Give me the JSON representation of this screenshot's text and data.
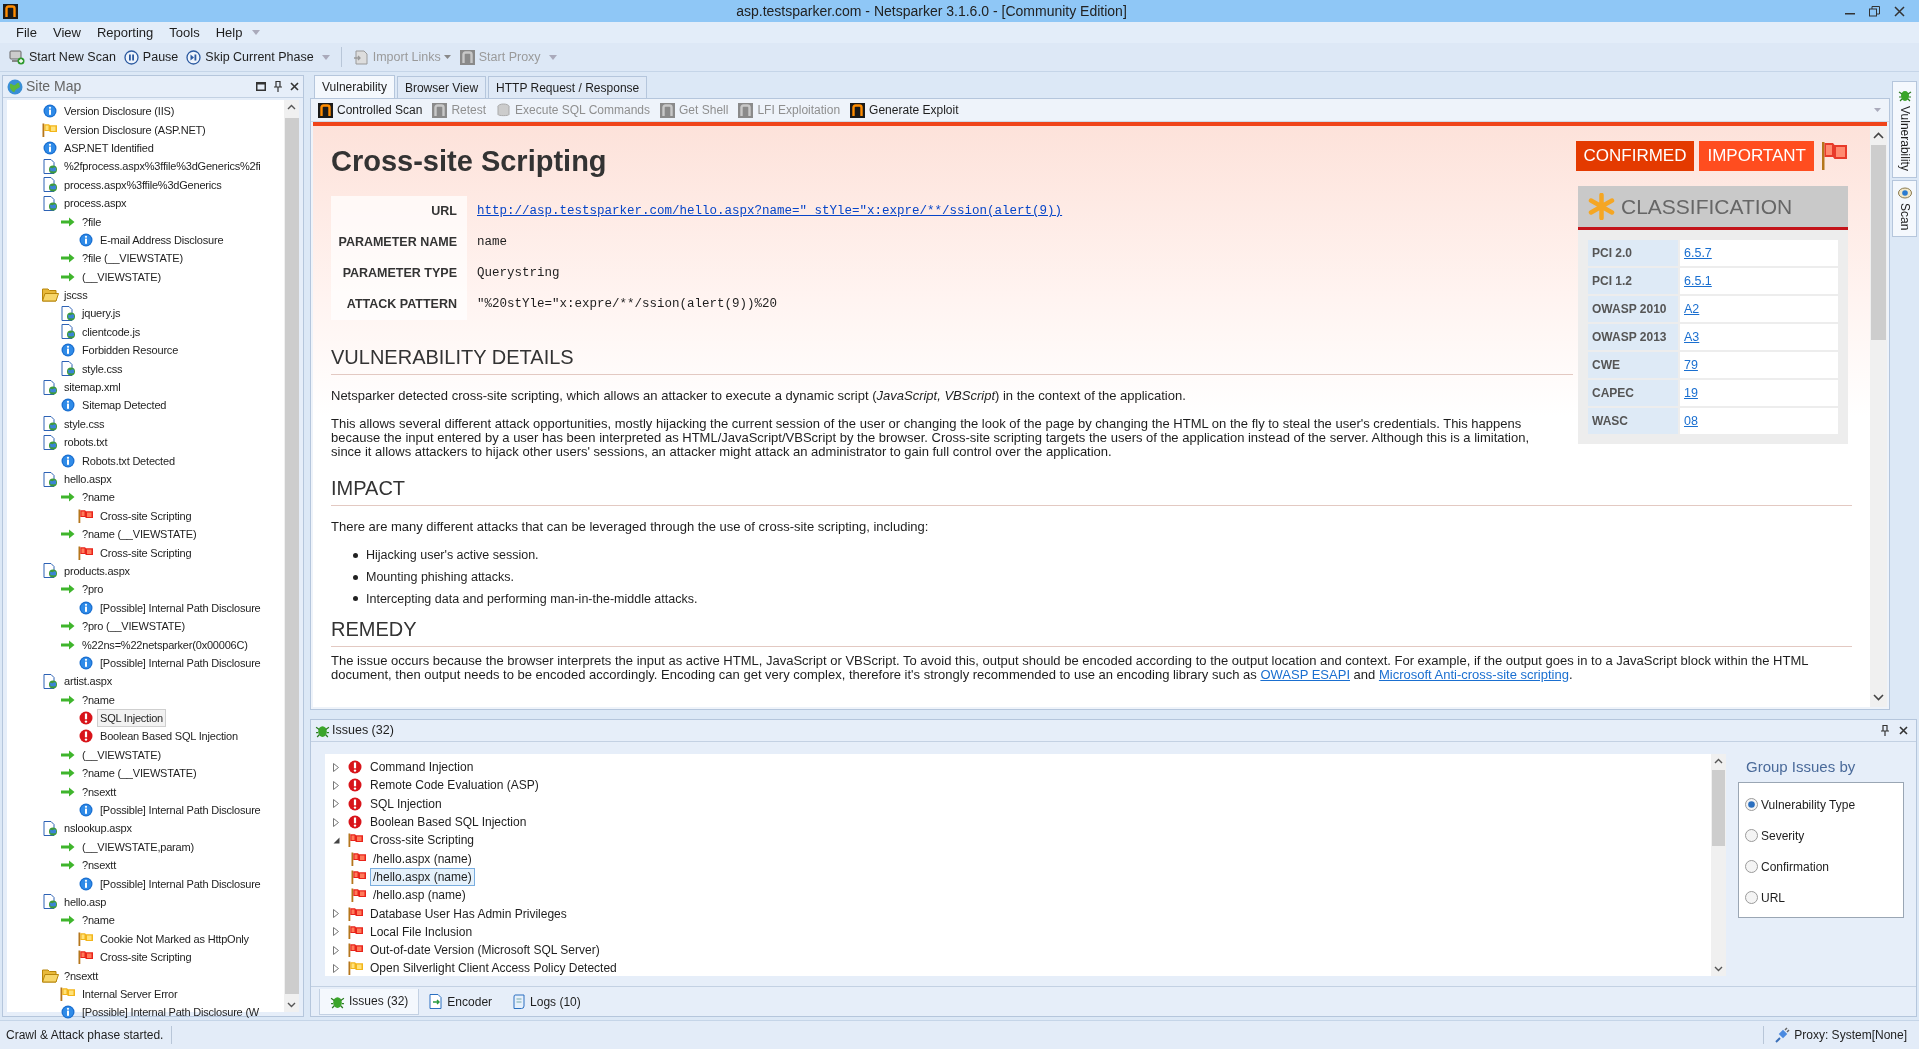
{
  "window": {
    "title": "asp.testsparker.com - Netsparker 3.1.6.0 - [Community Edition]"
  },
  "menu": [
    "File",
    "View",
    "Reporting",
    "Tools",
    "Help"
  ],
  "toolbar": [
    {
      "label": "Start New Scan",
      "kind": "scan",
      "disabled": false
    },
    {
      "label": "Pause",
      "kind": "pause",
      "disabled": false
    },
    {
      "label": "Skip Current Phase",
      "kind": "skip",
      "disabled": false
    },
    {
      "label": "Import Links",
      "kind": "import",
      "disabled": true
    },
    {
      "label": "Start Proxy",
      "kind": "proxy",
      "disabled": true
    }
  ],
  "site_map": {
    "title": "Site Map",
    "tree": [
      {
        "label": "Version Disclosure (IIS)",
        "kind": "info",
        "selected": false
      },
      {
        "label": "Version Disclosure (ASP.NET)",
        "kind": "flag-yellow",
        "selected": false
      },
      {
        "label": "ASP.NET Identified",
        "kind": "info",
        "selected": false
      },
      {
        "label": "%2fprocess.aspx%3ffile%3dGenerics%2fi",
        "kind": "page",
        "selected": false
      },
      {
        "label": "process.aspx%3ffile%3dGenerics",
        "kind": "page",
        "selected": false
      },
      {
        "label": "process.aspx",
        "kind": "page",
        "selected": false,
        "children": [
          {
            "label": "?file",
            "kind": "arrow",
            "selected": false,
            "children": [
              {
                "label": "E-mail Address Disclosure",
                "kind": "info",
                "selected": false
              }
            ]
          },
          {
            "label": "?file (__VIEWSTATE)",
            "kind": "arrow",
            "selected": false
          },
          {
            "label": "(__VIEWSTATE)",
            "kind": "arrow",
            "selected": false
          }
        ]
      },
      {
        "label": "jscss",
        "kind": "folder",
        "selected": false,
        "children": [
          {
            "label": "jquery.js",
            "kind": "page",
            "selected": false
          },
          {
            "label": "clientcode.js",
            "kind": "page",
            "selected": false
          },
          {
            "label": "Forbidden Resource",
            "kind": "info",
            "selected": false
          },
          {
            "label": "style.css",
            "kind": "page",
            "selected": false
          }
        ]
      },
      {
        "label": "sitemap.xml",
        "kind": "page",
        "selected": false,
        "children": [
          {
            "label": "Sitemap Detected",
            "kind": "info",
            "selected": false
          }
        ]
      },
      {
        "label": "style.css",
        "kind": "page",
        "selected": false
      },
      {
        "label": "robots.txt",
        "kind": "page",
        "selected": false,
        "children": [
          {
            "label": "Robots.txt Detected",
            "kind": "info",
            "selected": false
          }
        ]
      },
      {
        "label": "hello.aspx",
        "kind": "page",
        "selected": false,
        "children": [
          {
            "label": "?name",
            "kind": "arrow",
            "selected": false,
            "children": [
              {
                "label": "Cross-site Scripting",
                "kind": "flag-red",
                "selected": false
              }
            ]
          },
          {
            "label": "?name (__VIEWSTATE)",
            "kind": "arrow",
            "selected": false,
            "children": [
              {
                "label": "Cross-site Scripting",
                "kind": "flag-red",
                "selected": false
              }
            ]
          }
        ]
      },
      {
        "label": "products.aspx",
        "kind": "page",
        "selected": false,
        "children": [
          {
            "label": "?pro",
            "kind": "arrow",
            "selected": false,
            "children": [
              {
                "label": "[Possible] Internal Path Disclosure",
                "kind": "info",
                "selected": false
              }
            ]
          },
          {
            "label": "?pro (__VIEWSTATE)",
            "kind": "arrow",
            "selected": false
          },
          {
            "label": "%22ns=%22netsparker(0x00006C)",
            "kind": "arrow",
            "selected": false,
            "children": [
              {
                "label": "[Possible] Internal Path Disclosure",
                "kind": "info",
                "selected": false
              }
            ]
          }
        ]
      },
      {
        "label": "artist.aspx",
        "kind": "page",
        "selected": false,
        "children": [
          {
            "label": "?name",
            "kind": "arrow",
            "selected": false,
            "children": [
              {
                "label": "SQL Injection",
                "kind": "error",
                "selected": true
              },
              {
                "label": "Boolean Based SQL Injection",
                "kind": "error",
                "selected": false
              }
            ]
          },
          {
            "label": "(__VIEWSTATE)",
            "kind": "arrow",
            "selected": false
          },
          {
            "label": "?name (__VIEWSTATE)",
            "kind": "arrow",
            "selected": false
          },
          {
            "label": "?nsextt",
            "kind": "arrow",
            "selected": false,
            "children": [
              {
                "label": "[Possible] Internal Path Disclosure",
                "kind": "info",
                "selected": false
              }
            ]
          }
        ]
      },
      {
        "label": "nslookup.aspx",
        "kind": "page",
        "selected": false,
        "children": [
          {
            "label": "(__VIEWSTATE,param)",
            "kind": "arrow",
            "selected": false
          },
          {
            "label": "?nsextt",
            "kind": "arrow",
            "selected": false,
            "children": [
              {
                "label": "[Possible] Internal Path Disclosure",
                "kind": "info",
                "selected": false
              }
            ]
          }
        ]
      },
      {
        "label": "hello.asp",
        "kind": "page",
        "selected": false,
        "children": [
          {
            "label": "?name",
            "kind": "arrow",
            "selected": false,
            "children": [
              {
                "label": "Cookie Not Marked as HttpOnly",
                "kind": "flag-yellow",
                "selected": false
              },
              {
                "label": "Cross-site Scripting",
                "kind": "flag-red",
                "selected": false
              }
            ]
          }
        ]
      },
      {
        "label": "?nsextt",
        "kind": "folder",
        "selected": false,
        "children": [
          {
            "label": "Internal Server Error",
            "kind": "flag-yellow",
            "selected": false
          },
          {
            "label": "[Possible] Internal Path Disclosure (W",
            "kind": "info",
            "selected": false
          }
        ]
      }
    ]
  },
  "tabs": [
    {
      "label": "Vulnerability",
      "selected": true
    },
    {
      "label": "Browser View",
      "selected": false
    },
    {
      "label": "HTTP Request / Response",
      "selected": false
    }
  ],
  "actions": [
    {
      "label": "Controlled Scan",
      "disabled": false
    },
    {
      "label": "Retest",
      "disabled": true
    },
    {
      "label": "Execute SQL Commands",
      "disabled": true
    },
    {
      "label": "Get Shell",
      "disabled": true
    },
    {
      "label": "LFI Exploitation",
      "disabled": true
    },
    {
      "label": "Generate Exploit",
      "disabled": false
    }
  ],
  "report": {
    "title": "Cross-site Scripting",
    "badges": [
      {
        "label": "CONFIRMED",
        "color": "#e43a00"
      },
      {
        "label": "IMPORTANT",
        "color": "#ff4d1f"
      }
    ],
    "fields": [
      {
        "label": "URL",
        "value": "http://asp.testsparker.com/hello.aspx?name=\" stYle=\"x:expre/**/ssion(alert(9))",
        "kind": "link"
      },
      {
        "label": "PARAMETER NAME",
        "value": "name",
        "kind": "code"
      },
      {
        "label": "PARAMETER TYPE",
        "value": "Querystring",
        "kind": "code"
      },
      {
        "label": "ATTACK PATTERN",
        "value": "\"%20stYle=\"x:expre/**/ssion(alert(9))%20",
        "kind": "code"
      }
    ],
    "classification": {
      "title": "CLASSIFICATION",
      "rows": [
        {
          "label": "PCI 2.0",
          "value": "6.5.7"
        },
        {
          "label": "PCI 1.2",
          "value": "6.5.1"
        },
        {
          "label": "OWASP 2010",
          "value": "A2"
        },
        {
          "label": "OWASP 2013",
          "value": "A3"
        },
        {
          "label": "CWE",
          "value": "79"
        },
        {
          "label": "CAPEC",
          "value": "19"
        },
        {
          "label": "WASC",
          "value": "08"
        }
      ]
    },
    "sections": [
      {
        "heading": "VULNERABILITY DETAILS",
        "blocks": [
          {
            "kind": "paragraph",
            "text": "Netsparker detected cross-site scripting, which allows an attacker to execute a dynamic script (*JavaScript, VBScript*) in the context of the application."
          },
          {
            "kind": "paragraph",
            "text": "This allows several different attack opportunities, mostly hijacking the current session of the user or changing the look of the page by changing the HTML on the fly to steal the user's credentials. This happens because the input entered by a user has been interpreted as HTML/JavaScript/VBScript by the browser. Cross-site scripting targets the users of the application instead of the server. Although this is a limitation, since it allows attackers to hijack other users' sessions, an attacker might attack an administrator to gain full control over the application."
          }
        ]
      },
      {
        "heading": "IMPACT",
        "blocks": [
          {
            "kind": "paragraph",
            "text": "There are many different attacks that can be leveraged through the use of cross-site scripting, including:"
          },
          {
            "kind": "list",
            "items": [
              "Hijacking user's active session.",
              "Mounting phishing attacks.",
              "Intercepting data and performing man-in-the-middle attacks."
            ]
          }
        ]
      },
      {
        "heading": "REMEDY",
        "blocks": [
          {
            "kind": "linked_paragraph",
            "parts": [
              {
                "text": "The issue occurs because the browser interprets the input as active HTML, JavaScript or VBScript. To avoid this, output should be encoded according to the output location and context. For example, if the output goes in to a JavaScript block within the HTML document, then output needs to be encoded accordingly. Encoding can get very complex, therefore it's strongly recommended to use an encoding library such as "
              },
              {
                "link": "OWASP ESAPI"
              },
              {
                "text": " and "
              },
              {
                "link": "Microsoft Anti-cross-site scripting"
              },
              {
                "text": "."
              }
            ]
          }
        ]
      }
    ]
  },
  "side_tabs": [
    "Vulnerability",
    "Scan"
  ],
  "issues": {
    "title": "Issues (32)",
    "items": [
      {
        "label": "Command Injection",
        "kind": "error",
        "expanded": false,
        "selected": false
      },
      {
        "label": "Remote Code Evaluation (ASP)",
        "kind": "error",
        "expanded": false,
        "selected": false
      },
      {
        "label": "SQL Injection",
        "kind": "error",
        "expanded": false,
        "selected": false
      },
      {
        "label": "Boolean Based SQL Injection",
        "kind": "error",
        "expanded": false,
        "selected": false
      },
      {
        "label": "Cross-site Scripting",
        "kind": "flag-red",
        "expanded": true,
        "selected": false,
        "children": [
          {
            "label": "/hello.aspx (name)",
            "kind": "flag-red",
            "selected": false
          },
          {
            "label": "/hello.aspx (name)",
            "kind": "flag-red",
            "selected": true
          },
          {
            "label": "/hello.asp (name)",
            "kind": "flag-red",
            "selected": false
          }
        ]
      },
      {
        "label": "Database User Has Admin Privileges",
        "kind": "flag-red",
        "expanded": false,
        "selected": false
      },
      {
        "label": "Local File Inclusion",
        "kind": "flag-red",
        "expanded": false,
        "selected": false
      },
      {
        "label": "Out-of-date Version (Microsoft SQL Server)",
        "kind": "flag-red",
        "expanded": false,
        "selected": false
      },
      {
        "label": "Open Silverlight Client Access Policy Detected",
        "kind": "flag-yellow",
        "expanded": false,
        "selected": false
      }
    ],
    "group_by": {
      "title": "Group Issues by",
      "options": [
        {
          "label": "Vulnerability Type",
          "selected": true
        },
        {
          "label": "Severity",
          "selected": false
        },
        {
          "label": "Confirmation",
          "selected": false
        },
        {
          "label": "URL",
          "selected": false
        }
      ]
    }
  },
  "bottom_tabs": [
    {
      "label": "Issues (32)",
      "kind": "bug",
      "selected": true
    },
    {
      "label": "Encoder",
      "kind": "encoder",
      "selected": false
    },
    {
      "label": "Logs (10)",
      "kind": "log",
      "selected": false
    }
  ],
  "status_bar": {
    "message": "Crawl & Attack phase started.",
    "proxy": "Proxy: System[None]"
  }
}
